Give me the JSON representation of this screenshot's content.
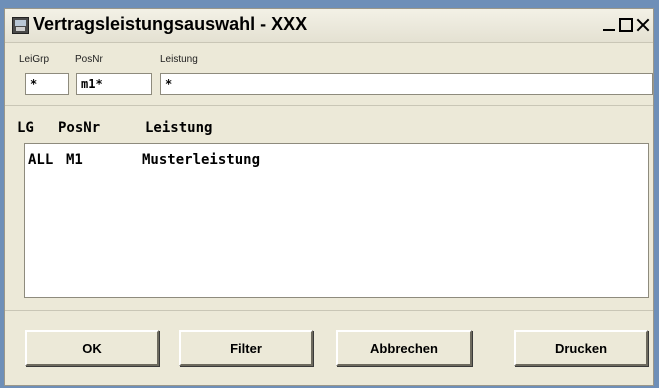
{
  "window": {
    "title": "Vertragsleistungsauswahl - XXX"
  },
  "filters": {
    "leigrp_label": "LeiGrp",
    "posnr_label": "PosNr",
    "leistung_label": "Leistung",
    "leigrp_value": "*",
    "posnr_value": "m1*",
    "leistung_value": "*"
  },
  "list": {
    "headers": [
      "LG",
      "PosNr",
      "Leistung"
    ],
    "rows": [
      [
        "ALL",
        "M1",
        "Musterleistung"
      ]
    ]
  },
  "buttons": {
    "ok": "OK",
    "filter": "Filter",
    "abbrechen": "Abbrechen",
    "drucken": "Drucken"
  }
}
